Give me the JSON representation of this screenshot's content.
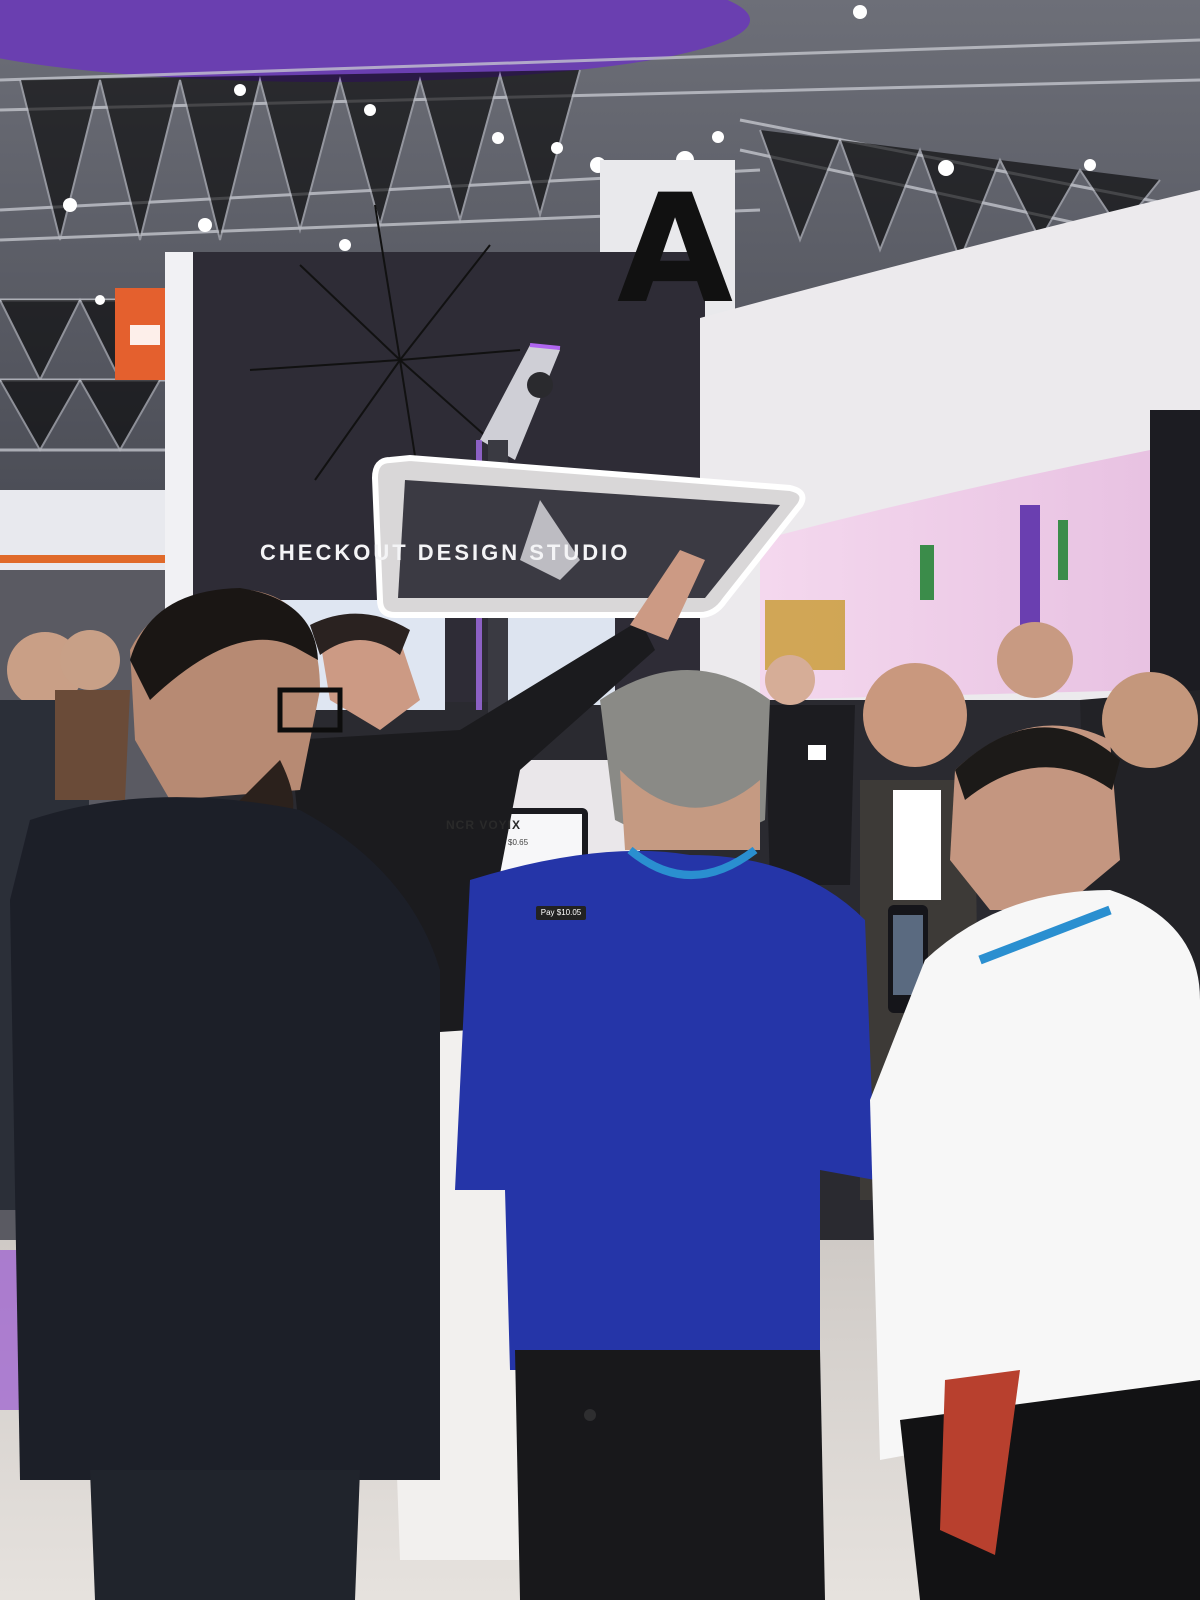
{
  "scene": {
    "booth_sign": "CHECKOUT DESIGN STUDIO",
    "hall_letter": "A",
    "kiosk_brand": "NCR VOYIX",
    "kiosk_item_price": "$0.65",
    "kiosk_pay_label": "Pay $10.05"
  },
  "colors": {
    "ceiling_purple": "#6a3fb0",
    "booth_wall": "#2e2c36",
    "screen_pink": "#e8c9e6",
    "lanyard_blue": "#2a8fd0",
    "sweater_blue": "#2535a8"
  }
}
